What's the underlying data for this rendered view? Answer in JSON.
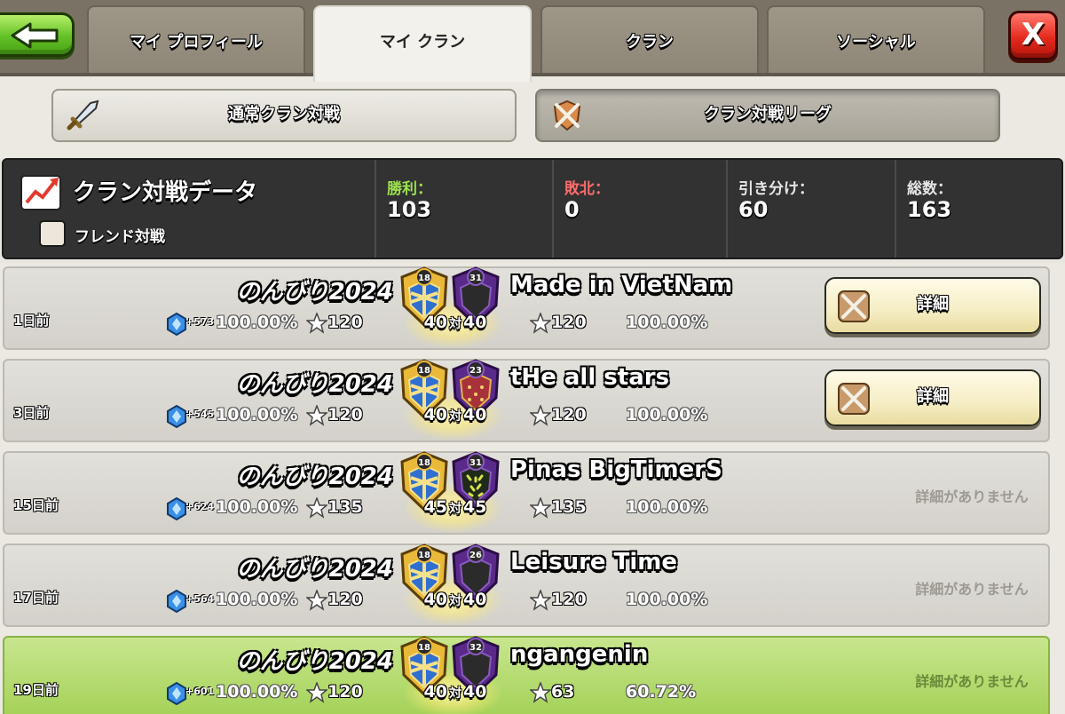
{
  "tabs": [
    {
      "label": "マイ プロフィール"
    },
    {
      "label": "マイ クラン"
    },
    {
      "label": "クラン"
    },
    {
      "label": "ソーシャル"
    }
  ],
  "close_label": "X",
  "subnav": {
    "normal": "通常クラン対戦",
    "league": "クラン対戦リーグ"
  },
  "stats": {
    "title": "クラン対戦データ",
    "friend_label": "フレンド対戦",
    "wins_label": "勝利：",
    "wins": "103",
    "losses_label": "敗北：",
    "losses": "0",
    "draws_label": "引き分け：",
    "draws": "60",
    "total_label": "総数：",
    "total": "163"
  },
  "vs_word": "対",
  "detail_label": "詳細",
  "no_detail_label": "詳細がありません",
  "wars": [
    {
      "ago": "1日前",
      "my_clan": "のんびり2024",
      "opponent": "Made in VietNam",
      "xp": "+573",
      "my_pct": "100.00%",
      "my_stars": "120",
      "opp_stars": "120",
      "opp_pct": "100.00%",
      "my_size": "40",
      "opp_size": "40",
      "my_level": "18",
      "opp_level": "31",
      "result": "draw",
      "has_detail": true
    },
    {
      "ago": "3日前",
      "my_clan": "のんびり2024",
      "opponent": "tHe all stars",
      "xp": "+545",
      "my_pct": "100.00%",
      "my_stars": "120",
      "opp_stars": "120",
      "opp_pct": "100.00%",
      "my_size": "40",
      "opp_size": "40",
      "my_level": "18",
      "opp_level": "23",
      "result": "draw",
      "has_detail": true
    },
    {
      "ago": "15日前",
      "my_clan": "のんびり2024",
      "opponent": "Pinas BigTimerS",
      "xp": "+624",
      "my_pct": "100.00%",
      "my_stars": "135",
      "opp_stars": "135",
      "opp_pct": "100.00%",
      "my_size": "45",
      "opp_size": "45",
      "my_level": "18",
      "opp_level": "31",
      "result": "draw",
      "has_detail": false
    },
    {
      "ago": "17日前",
      "my_clan": "のんびり2024",
      "opponent": "Leisure Time",
      "xp": "+564",
      "my_pct": "100.00%",
      "my_stars": "120",
      "opp_stars": "120",
      "opp_pct": "100.00%",
      "my_size": "40",
      "opp_size": "40",
      "my_level": "18",
      "opp_level": "26",
      "result": "draw",
      "has_detail": false
    },
    {
      "ago": "19日前",
      "my_clan": "のんびり2024",
      "opponent": "ngangenin",
      "xp": "+601",
      "my_pct": "100.00%",
      "my_stars": "120",
      "opp_stars": "63",
      "opp_pct": "60.72%",
      "my_size": "40",
      "opp_size": "40",
      "my_level": "18",
      "opp_level": "32",
      "result": "win",
      "has_detail": false
    }
  ],
  "colors": {
    "win_row": "#a4d157",
    "wins_label": "#9be04e",
    "losses_label": "#ff6b6b",
    "my_badge": "#e9b93a",
    "opp_badge": "#5a2a8a"
  }
}
